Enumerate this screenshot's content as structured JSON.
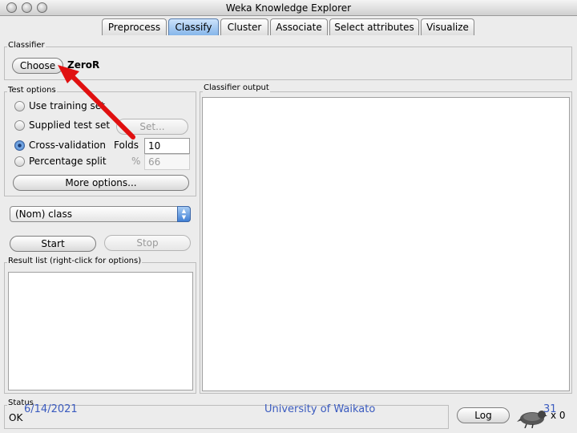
{
  "window": {
    "title": "Weka Knowledge Explorer"
  },
  "tabs": [
    {
      "label": "Preprocess",
      "active": false
    },
    {
      "label": "Classify",
      "active": true
    },
    {
      "label": "Cluster",
      "active": false
    },
    {
      "label": "Associate",
      "active": false
    },
    {
      "label": "Select attributes",
      "active": false
    },
    {
      "label": "Visualize",
      "active": false
    }
  ],
  "classifier": {
    "group_label": "Classifier",
    "choose_label": "Choose",
    "name": "ZeroR"
  },
  "test_options": {
    "group_label": "Test options",
    "options": [
      {
        "label": "Use training set",
        "checked": false
      },
      {
        "label": "Supplied test set",
        "checked": false
      },
      {
        "label": "Cross-validation",
        "checked": true
      },
      {
        "label": "Percentage split",
        "checked": false
      }
    ],
    "set_button": "Set...",
    "folds_label": "Folds",
    "folds_value": "10",
    "percent_label": "%",
    "percent_value": "66",
    "more_options": "More options..."
  },
  "class_select": {
    "value": "(Nom) class"
  },
  "actions": {
    "start_label": "Start",
    "stop_label": "Stop"
  },
  "result_list": {
    "group_label": "Result list (right-click for options)"
  },
  "classifier_output": {
    "group_label": "Classifier output"
  },
  "status": {
    "group_label": "Status",
    "text": "OK",
    "log_label": "Log",
    "count": "x 0"
  },
  "footer": {
    "date": "6/14/2021",
    "institution": "University of Waikato",
    "page": "31"
  },
  "colors": {
    "accent": "#3d76c4",
    "annotation_arrow": "#e01010",
    "footer_text": "#3b5bbf"
  },
  "icons": {
    "status": "weka-bird-icon",
    "annotation": "red-arrow-pointer"
  }
}
